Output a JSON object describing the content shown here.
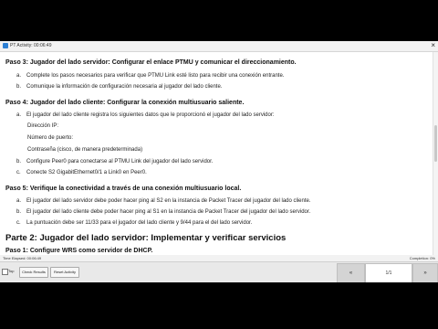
{
  "window": {
    "title": "PT Activity: 00:06:49",
    "close": "×"
  },
  "content": {
    "step3": {
      "title": "Paso 3:  Jugador del lado servidor: Configurar el enlace PTMU y comunicar el direccionamiento.",
      "items": [
        {
          "label": "a.",
          "text": "Complete los pasos necesarios para verificar que PTMU Link esté listo para recibir una conexión entrante."
        },
        {
          "label": "b.",
          "text": "Comunique la información de configuración necesaria al jugador del lado cliente."
        }
      ]
    },
    "step4": {
      "title": "Paso 4:  Jugador del lado cliente: Configurar la conexión multiusuario saliente.",
      "items": [
        {
          "label": "a.",
          "text": "El jugador del lado cliente registra los siguientes datos que le proporcionó el jugador del lado servidor:"
        },
        {
          "label": "b.",
          "text": "Configure Peer0 para conectarse al PTMU Link del jugador del lado servidor."
        },
        {
          "label": "c.",
          "text": "Conecte S2 GigabitEthernet0/1 a Link0 en Peer0."
        }
      ],
      "subitems": [
        "Dirección IP:",
        "Número de puerto:",
        "Contraseña (cisco, de manera predeterminada)"
      ]
    },
    "step5": {
      "title": "Paso 5:  Verifique la conectividad a través de una conexión multiusuario local.",
      "items": [
        {
          "label": "a.",
          "text": "El jugador del lado servidor debe poder hacer ping al S2 en la instancia de Packet Tracer del jugador del lado cliente."
        },
        {
          "label": "b.",
          "text": "El jugador del lado cliente debe poder hacer ping al S1 en la instancia de Packet Tracer del jugador del lado servidor."
        },
        {
          "label": "c.",
          "text": "La puntuación debe ser 11/33 para el jugador del lado cliente y 9/44 para el del lado servidor."
        }
      ]
    },
    "part2": "Parte 2:  Jugador del lado servidor: Implementar y verificar servicios",
    "step1": "Paso 1:   Configure WRS como servidor de DHCP."
  },
  "status": {
    "left": "Time Elapsed: 00:06:49",
    "right": "Completion: 0%"
  },
  "bottom": {
    "top_label": "Top",
    "check_results": "Check Results",
    "reset_activity": "Reset Activity",
    "prev": "«",
    "page": "1/1",
    "next": "»"
  }
}
